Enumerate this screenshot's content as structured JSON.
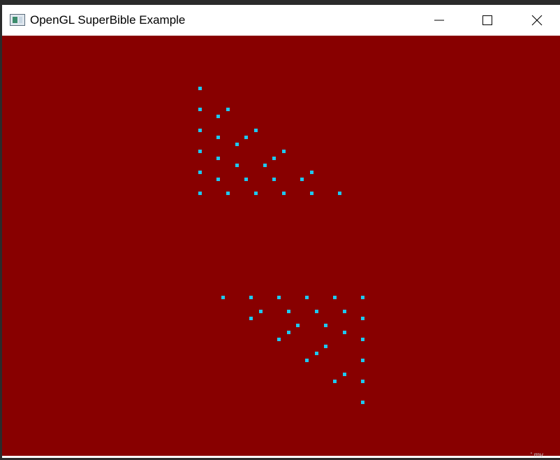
{
  "window": {
    "title": "OpenGL SuperBible Example",
    "icon": "app-window-icon"
  },
  "controls": {
    "minimize_icon": "minimize-icon",
    "maximize_icon": "maximize-icon",
    "close_icon": "close-icon"
  },
  "canvas": {
    "background": "#880000",
    "point_color": "#1ec8f0"
  },
  "taskbar": {
    "hint": "' mv"
  }
}
